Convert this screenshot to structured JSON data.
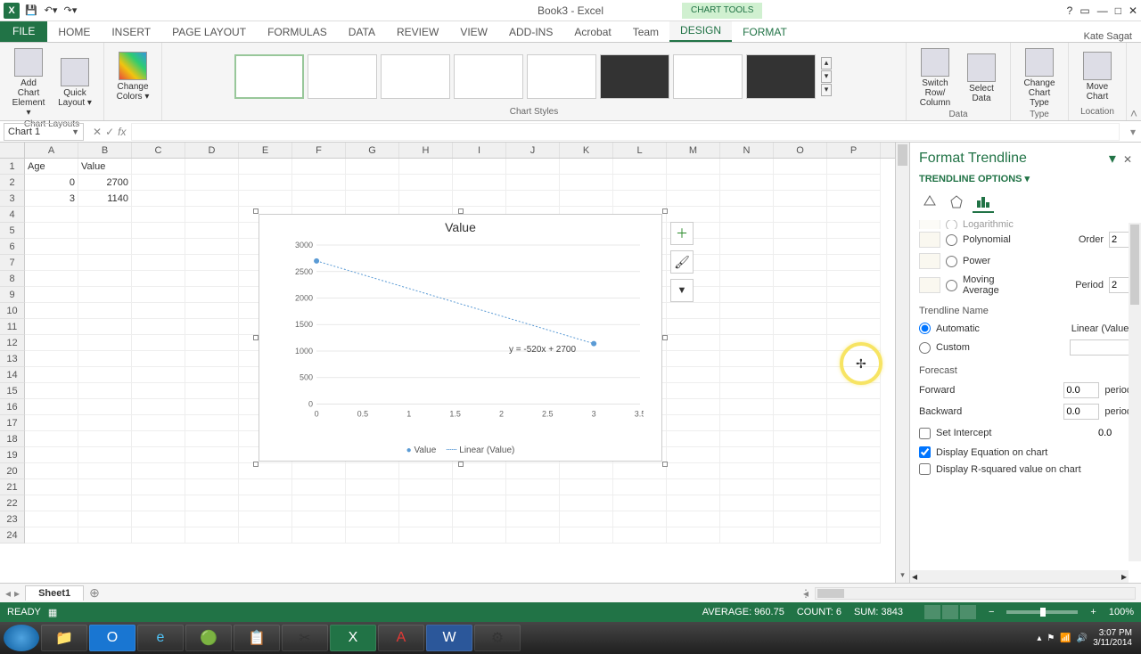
{
  "titlebar": {
    "title": "Book3 - Excel",
    "chart_tools": "CHART TOOLS"
  },
  "tabs": {
    "file": "FILE",
    "home": "HOME",
    "insert": "INSERT",
    "pagelayout": "PAGE LAYOUT",
    "formulas": "FORMULAS",
    "data": "DATA",
    "review": "REVIEW",
    "view": "VIEW",
    "addins": "ADD-INS",
    "acrobat": "Acrobat",
    "team": "Team",
    "design": "DESIGN",
    "format": "FORMAT"
  },
  "user": "Kate Sagat",
  "ribbon": {
    "layouts": {
      "add_element": "Add Chart Element ▾",
      "quick_layout": "Quick Layout ▾",
      "group": "Chart Layouts"
    },
    "colors": {
      "change_colors": "Change Colors ▾"
    },
    "styles_group": "Chart Styles",
    "data": {
      "switch": "Switch Row/\nColumn",
      "select": "Select Data",
      "group": "Data"
    },
    "type": {
      "change": "Change Chart Type",
      "group": "Type"
    },
    "location": {
      "move": "Move Chart",
      "group": "Location"
    }
  },
  "namebox": "Chart 1",
  "fx_label": "fx",
  "columns": [
    "A",
    "B",
    "C",
    "D",
    "E",
    "F",
    "G",
    "H",
    "I",
    "J",
    "K",
    "L",
    "M",
    "N",
    "O",
    "P"
  ],
  "rows": [
    1,
    2,
    3,
    4,
    5,
    6,
    7,
    8,
    9,
    10,
    11,
    12,
    13,
    14,
    15,
    16,
    17,
    18,
    19,
    20,
    21,
    22,
    23,
    24
  ],
  "sheet_data": {
    "A1": "Age",
    "B1": "Value",
    "A2": "0",
    "B2": "2700",
    "A3": "3",
    "B3": "1140"
  },
  "chart": {
    "title": "Value",
    "equation": "y = -520x + 2700",
    "legend_series": "Value",
    "legend_trend": "Linear (Value)"
  },
  "chart_data": {
    "type": "scatter",
    "title": "Value",
    "x": [
      0,
      3
    ],
    "y": [
      2700,
      1140
    ],
    "series_name": "Value",
    "trendline": {
      "type": "linear",
      "equation": "y = -520x + 2700",
      "slope": -520,
      "intercept": 2700,
      "label": "Linear (Value)"
    },
    "xlim": [
      0,
      3.5
    ],
    "ylim": [
      0,
      3000
    ],
    "xticks": [
      0,
      0.5,
      1,
      1.5,
      2,
      2.5,
      3,
      3.5
    ],
    "yticks": [
      0,
      500,
      1000,
      1500,
      2000,
      2500,
      3000
    ]
  },
  "side_panel": {
    "title": "Format Trendline",
    "subtitle": "TRENDLINE OPTIONS ▾",
    "opt_log": "Logarithmic",
    "opt_poly": "Polynomial",
    "order_label": "Order",
    "order_val": "2",
    "opt_power": "Power",
    "opt_moving": "Moving Average",
    "period_label": "Period",
    "period_val": "2",
    "name_section": "Trendline Name",
    "auto": "Automatic",
    "auto_val": "Linear (Value)",
    "custom": "Custom",
    "forecast": "Forecast",
    "forward": "Forward",
    "forward_val": "0.0",
    "period_unit": "period",
    "backward": "Backward",
    "backward_val": "0.0",
    "set_intercept": "Set Intercept",
    "intercept_val": "0.0",
    "disp_eq": "Display Equation on chart",
    "disp_r2": "Display R-squared value on chart"
  },
  "sheet_tabs": {
    "sheet1": "Sheet1"
  },
  "status": {
    "ready": "READY",
    "average": "AVERAGE: 960.75",
    "count": "COUNT: 6",
    "sum": "SUM: 3843",
    "zoom": "100%"
  },
  "tray": {
    "time": "3:07 PM",
    "date": "3/11/2014"
  }
}
